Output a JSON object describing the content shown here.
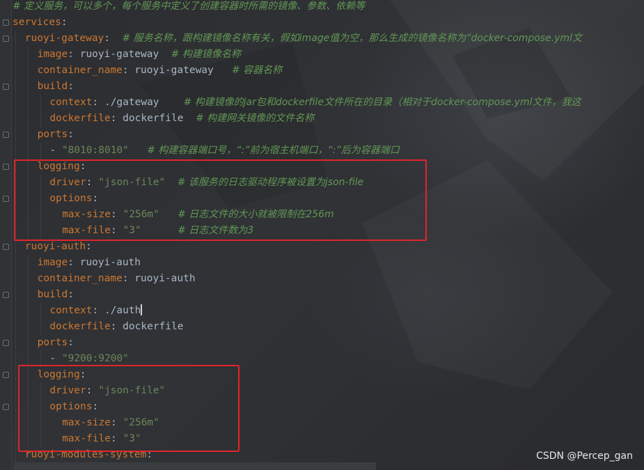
{
  "editor": {
    "lines": [
      {
        "indent": 0,
        "parts": [
          {
            "t": "c",
            "v": "# 定义服务，可以多个，每个服务中定义了创建容器时所需的镜像、参数、依赖等"
          }
        ]
      },
      {
        "indent": 0,
        "parts": [
          {
            "t": "k",
            "v": "services"
          },
          {
            "t": "p",
            "v": ":"
          }
        ]
      },
      {
        "indent": 1,
        "parts": [
          {
            "t": "k",
            "v": "ruoyi-gateway"
          },
          {
            "t": "p",
            "v": ":  "
          },
          {
            "t": "c",
            "v": "# 服务名称，跟构建镜像名称有关，假如image值为空，那么生成的镜像名称为“docker-compose.yml文"
          }
        ]
      },
      {
        "indent": 2,
        "parts": [
          {
            "t": "k",
            "v": "image"
          },
          {
            "t": "p",
            "v": ": "
          },
          {
            "t": "v",
            "v": "ruoyi-gateway  "
          },
          {
            "t": "c",
            "v": "# 构建镜像名称"
          }
        ]
      },
      {
        "indent": 2,
        "parts": [
          {
            "t": "k",
            "v": "container_name"
          },
          {
            "t": "p",
            "v": ": "
          },
          {
            "t": "v",
            "v": "ruoyi-gateway   "
          },
          {
            "t": "c",
            "v": "# 容器名称"
          }
        ]
      },
      {
        "indent": 2,
        "parts": [
          {
            "t": "k",
            "v": "build"
          },
          {
            "t": "p",
            "v": ":"
          }
        ]
      },
      {
        "indent": 3,
        "parts": [
          {
            "t": "k",
            "v": "context"
          },
          {
            "t": "p",
            "v": ": "
          },
          {
            "t": "v",
            "v": "./gateway    "
          },
          {
            "t": "c",
            "v": "# 构建镜像的jar包和dockerfile文件所在的目录（相对于docker-compose.yml文件，我这"
          }
        ]
      },
      {
        "indent": 3,
        "parts": [
          {
            "t": "k",
            "v": "dockerfile"
          },
          {
            "t": "p",
            "v": ": "
          },
          {
            "t": "v",
            "v": "dockerfile  "
          },
          {
            "t": "c",
            "v": "# 构建网关镜像的文件名称"
          }
        ]
      },
      {
        "indent": 2,
        "parts": [
          {
            "t": "k",
            "v": "ports"
          },
          {
            "t": "p",
            "v": ":"
          }
        ]
      },
      {
        "indent": 3,
        "parts": [
          {
            "t": "p",
            "v": "- "
          },
          {
            "t": "s",
            "v": "\"8010:8010\"   "
          },
          {
            "t": "c",
            "v": "# 构建容器端口号，“:”前为宿主机端口，“:”后为容器端口"
          }
        ]
      },
      {
        "indent": 2,
        "parts": [
          {
            "t": "k",
            "v": "logging"
          },
          {
            "t": "p",
            "v": ":"
          }
        ]
      },
      {
        "indent": 3,
        "parts": [
          {
            "t": "k",
            "v": "driver"
          },
          {
            "t": "p",
            "v": ": "
          },
          {
            "t": "s",
            "v": "\"json-file\"  "
          },
          {
            "t": "c",
            "v": "# 该服务的日志驱动程序被设置为json-file"
          }
        ]
      },
      {
        "indent": 3,
        "parts": [
          {
            "t": "k",
            "v": "options"
          },
          {
            "t": "p",
            "v": ":"
          }
        ]
      },
      {
        "indent": 4,
        "parts": [
          {
            "t": "k",
            "v": "max-size"
          },
          {
            "t": "p",
            "v": ": "
          },
          {
            "t": "s",
            "v": "\"256m\"   "
          },
          {
            "t": "c",
            "v": "# 日志文件的大小就被限制在256m"
          }
        ]
      },
      {
        "indent": 4,
        "parts": [
          {
            "t": "k",
            "v": "max-file"
          },
          {
            "t": "p",
            "v": ": "
          },
          {
            "t": "s",
            "v": "\"3\"      "
          },
          {
            "t": "c",
            "v": "# 日志文件数为3"
          }
        ]
      },
      {
        "indent": 1,
        "parts": [
          {
            "t": "k",
            "v": "ruoyi-auth"
          },
          {
            "t": "p",
            "v": ":"
          }
        ]
      },
      {
        "indent": 2,
        "parts": [
          {
            "t": "k",
            "v": "image"
          },
          {
            "t": "p",
            "v": ": "
          },
          {
            "t": "v",
            "v": "ruoyi-auth"
          }
        ]
      },
      {
        "indent": 2,
        "parts": [
          {
            "t": "k",
            "v": "container_name"
          },
          {
            "t": "p",
            "v": ": "
          },
          {
            "t": "v",
            "v": "ruoyi-auth"
          }
        ]
      },
      {
        "indent": 2,
        "parts": [
          {
            "t": "k",
            "v": "build"
          },
          {
            "t": "p",
            "v": ":"
          }
        ]
      },
      {
        "indent": 3,
        "parts": [
          {
            "t": "k",
            "v": "context"
          },
          {
            "t": "p",
            "v": ": "
          },
          {
            "t": "v",
            "v": "./auth"
          },
          {
            "t": "caret",
            "v": ""
          }
        ]
      },
      {
        "indent": 3,
        "parts": [
          {
            "t": "k",
            "v": "dockerfile"
          },
          {
            "t": "p",
            "v": ": "
          },
          {
            "t": "v",
            "v": "dockerfile"
          }
        ]
      },
      {
        "indent": 2,
        "parts": [
          {
            "t": "k",
            "v": "ports"
          },
          {
            "t": "p",
            "v": ":"
          }
        ]
      },
      {
        "indent": 3,
        "parts": [
          {
            "t": "p",
            "v": "- "
          },
          {
            "t": "s",
            "v": "\"9200:9200\""
          }
        ]
      },
      {
        "indent": 2,
        "parts": [
          {
            "t": "k",
            "v": "logging"
          },
          {
            "t": "p",
            "v": ":"
          }
        ]
      },
      {
        "indent": 3,
        "parts": [
          {
            "t": "k",
            "v": "driver"
          },
          {
            "t": "p",
            "v": ": "
          },
          {
            "t": "s",
            "v": "\"json-file\""
          }
        ]
      },
      {
        "indent": 3,
        "parts": [
          {
            "t": "k",
            "v": "options"
          },
          {
            "t": "p",
            "v": ":"
          }
        ]
      },
      {
        "indent": 4,
        "parts": [
          {
            "t": "k",
            "v": "max-size"
          },
          {
            "t": "p",
            "v": ": "
          },
          {
            "t": "s",
            "v": "\"256m\""
          }
        ]
      },
      {
        "indent": 4,
        "parts": [
          {
            "t": "k",
            "v": "max-file"
          },
          {
            "t": "p",
            "v": ": "
          },
          {
            "t": "s",
            "v": "\"3\""
          }
        ]
      },
      {
        "indent": 1,
        "parts": [
          {
            "t": "k",
            "v": "ruoyi-modules-system"
          },
          {
            "t": "p",
            "v": ":"
          }
        ]
      }
    ]
  },
  "highlight_color": "#e0252a",
  "colors": {
    "key": "#cc7832",
    "string": "#6a8759",
    "comment": "#629755",
    "plain": "#a9b7c6",
    "background": "#2b2b2b"
  },
  "watermark": "CSDN @Percep_gan"
}
